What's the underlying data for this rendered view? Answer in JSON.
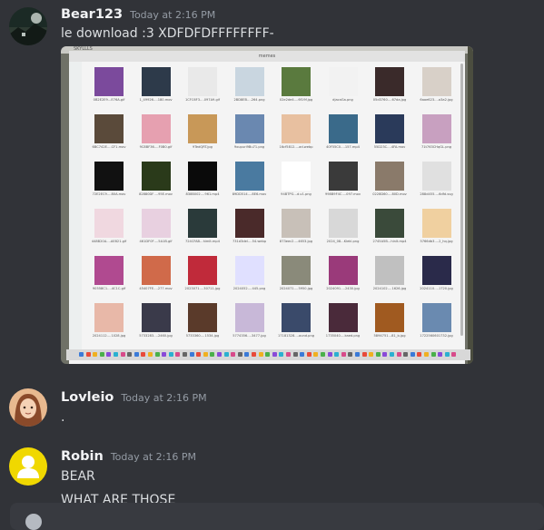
{
  "messages": [
    {
      "username": "Bear123",
      "timestamp": "Today at 2:16 PM",
      "text": "le download :3 XDFDFDFFFFFFFF-",
      "avatar_icon": "night-landscape-avatar-icon"
    },
    {
      "username": "Lovleio",
      "timestamp": "Today at 2:16 PM",
      "text": ".",
      "avatar_icon": "anime-girl-avatar-icon"
    },
    {
      "username": "Robin",
      "timestamp": "Today at 2:16 PM",
      "text_lines": [
        "BEAR",
        "WHAT ARE THOSE"
      ],
      "avatar_icon": "default-user-avatar-icon"
    }
  ],
  "attachment": {
    "window_title": "memes",
    "corner_label": "SKYLLLS",
    "files": [
      "0B2E2E9…E76A.gif",
      "1_49926….180.mov",
      "1CFC6F3….097A9.gif",
      "2BD8EB….264.png",
      "02e2de4….6f19f.jpg",
      "djacaGa.png",
      "05d3760….67da.jpg",
      "6aae623….a3a2.jpg",
      "6BC742E….CF1.mov",
      "9C8BF36….F0B0.gif",
      "9TedQRT.jpg",
      "9xupuri9Bu71.png",
      "16cf5812….ad.webp",
      "40F55C0….157.mp4",
      "55D23C….4FA.mov",
      "71t763CHqGL.png",
      "72E2EC9….80A.mov",
      "82880DF….95E.mov",
      "838B002….961.mp4",
      "89DD514….8E6.mov",
      "94BTPG…d-v1.png",
      "998B9F4C….097.mov",
      "0228D60….80D.mov",
      "288d455….6dfd.svg",
      "448B20A….AE821.gif",
      "461DF0F….5A1B.gif",
      "724CFAB…himlt.mp4",
      "731d3del….54.webp",
      "873eec2….4653.jpg",
      "2024_08…Klekl.png",
      "2745A5B…hinlt.mp4",
      "5766db3….2_hq.jpg",
      "90558C1….4C1C.gif",
      "45407FE….277.mov",
      "2023071….30711.jpg",
      "2024052….445.png",
      "2024071….5950.jpg",
      "2024091….2430.jpg",
      "2024102….1626.jpg",
      "2024110….1720.jpg",
      "2024112….1028.jpg",
      "5733283….2460.jpg",
      "5733360….1534.jpg",
      "5774356….3477.jpg",
      "17181328….ound.png",
      "1735040….kaed.png",
      "5894751…81_b.jpg",
      "1722560601732.jpg"
    ]
  },
  "colors": {
    "background": "#313338",
    "username": "#f2f3f5",
    "timestamp": "#949ba4",
    "text": "#dbdee1",
    "composer": "#383a40"
  }
}
